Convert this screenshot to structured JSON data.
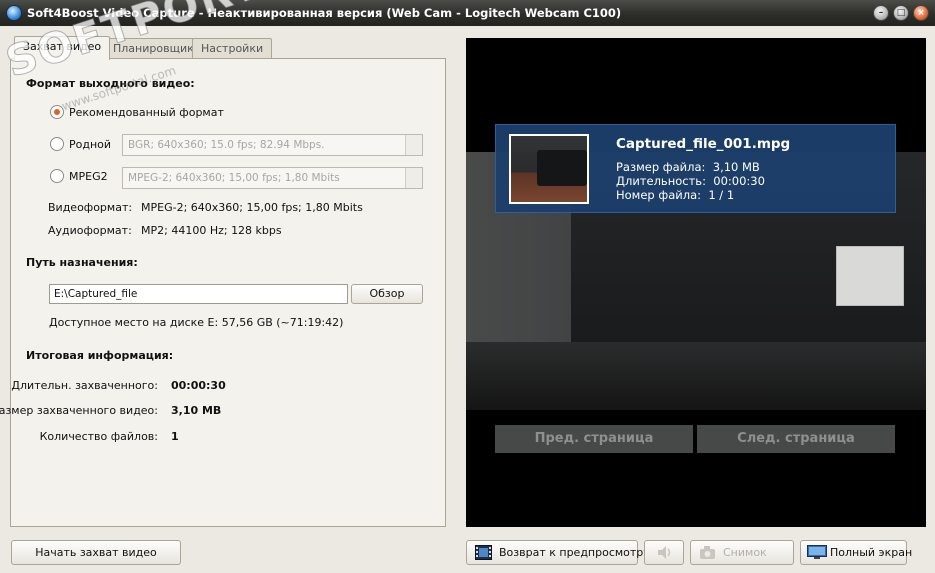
{
  "window": {
    "title": "Soft4Boost Video Capture - Неактивированная версия (Web Cam - Logitech Webcam C100)"
  },
  "tabs": [
    {
      "label": "Захват видео",
      "active": true
    },
    {
      "label": "Планировщик",
      "active": false
    },
    {
      "label": "Настройки",
      "active": false
    }
  ],
  "watermark": {
    "text": "SOFTPORTAL",
    "url": "www.softportal.com"
  },
  "output_format": {
    "heading": "Формат выходного видео:",
    "options": [
      {
        "label": "Рекомендованный формат",
        "checked": true
      },
      {
        "label": "Родной",
        "checked": false,
        "value": "BGR; 640x360; 15.0 fps; 82.94 Mbps."
      },
      {
        "label": "MPEG2",
        "checked": false,
        "value": "MPEG-2; 640x360; 15,00 fps; 1,80 Mbits"
      }
    ],
    "video_label": "Видеоформат:",
    "video_value": "MPEG-2; 640x360; 15,00 fps; 1,80 Mbits",
    "audio_label": "Аудиоформат:",
    "audio_value": "MP2; 44100 Hz; 128 kbps"
  },
  "destination": {
    "heading": "Путь назначения:",
    "path": "E:\\Captured_file",
    "browse_label": "Обзор",
    "free_space": "Доступное место на диске E: 57,56 GB (~71:19:42)"
  },
  "summary": {
    "heading": "Итоговая информация:",
    "rows": [
      {
        "label": "Длительн. захваченного:",
        "value": "00:00:30"
      },
      {
        "label": "Размер захваченного видео:",
        "value": "3,10 MB"
      },
      {
        "label": "Количество файлов:",
        "value": "1"
      }
    ]
  },
  "preview": {
    "file_name": "Captured_file_001.mpg",
    "lines": [
      {
        "label": "Размер файла:",
        "value": "3,10 MB"
      },
      {
        "label": "Длительность:",
        "value": "00:00:30"
      },
      {
        "label": "Номер файла:",
        "value": "1 / 1"
      }
    ],
    "prev_page": "Пред. страница",
    "next_page": "След. страница"
  },
  "bottom": {
    "start_capture": "Начать захват видео",
    "back_preview": "Возврат к предпросмотру",
    "snapshot": "Снимок",
    "fullscreen": "Полный экран"
  },
  "colors": {
    "accent_radio": "#e0602c",
    "info_panel": "#1c3f6c",
    "title_bar": "#2d2e2a"
  }
}
